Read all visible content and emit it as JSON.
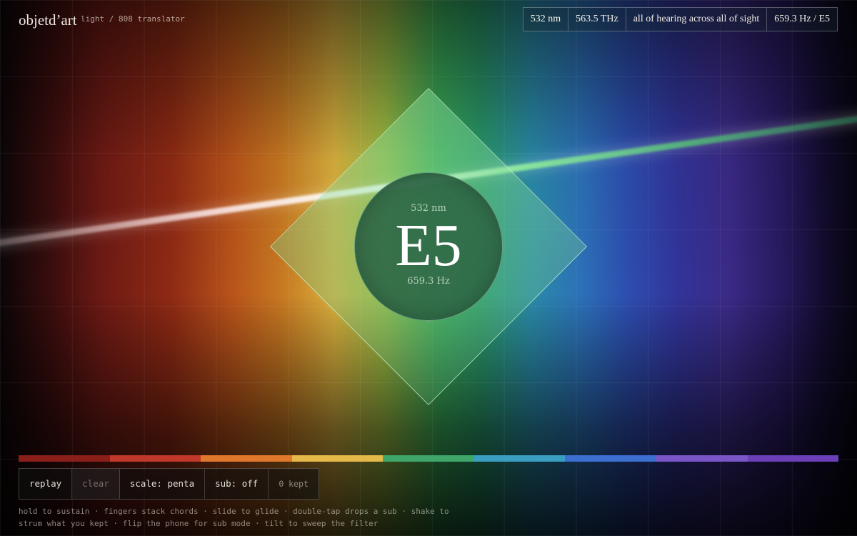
{
  "brand": {
    "logo": "objetd’art",
    "subtitle": "light / 808 translator"
  },
  "readout": {
    "wavelength": "532 nm",
    "frequency": "563.5 THz",
    "tagline": "all of hearing across all of sight",
    "pitch": "659.3 Hz / E5"
  },
  "center": {
    "wavelength": "532 nm",
    "note": "E5",
    "frequency": "659.3 Hz"
  },
  "spectrum_bands": [
    "#8a1f1a",
    "#c0382a",
    "#e0782c",
    "#e5b84a",
    "#3fa66a",
    "#3a9ec0",
    "#3d6fd0",
    "#7a55c8",
    "#6a3fb8"
  ],
  "controls": {
    "replay": "replay",
    "clear": "clear",
    "scale": "scale: penta",
    "sub": "sub: off",
    "kept": "0 kept"
  },
  "hints": {
    "line1": "hold to sustain · fingers stack chords · slide to glide · double-tap drops a sub · shake to",
    "line2": "strum what you kept · flip the phone for sub mode · tilt to sweep the filter"
  }
}
